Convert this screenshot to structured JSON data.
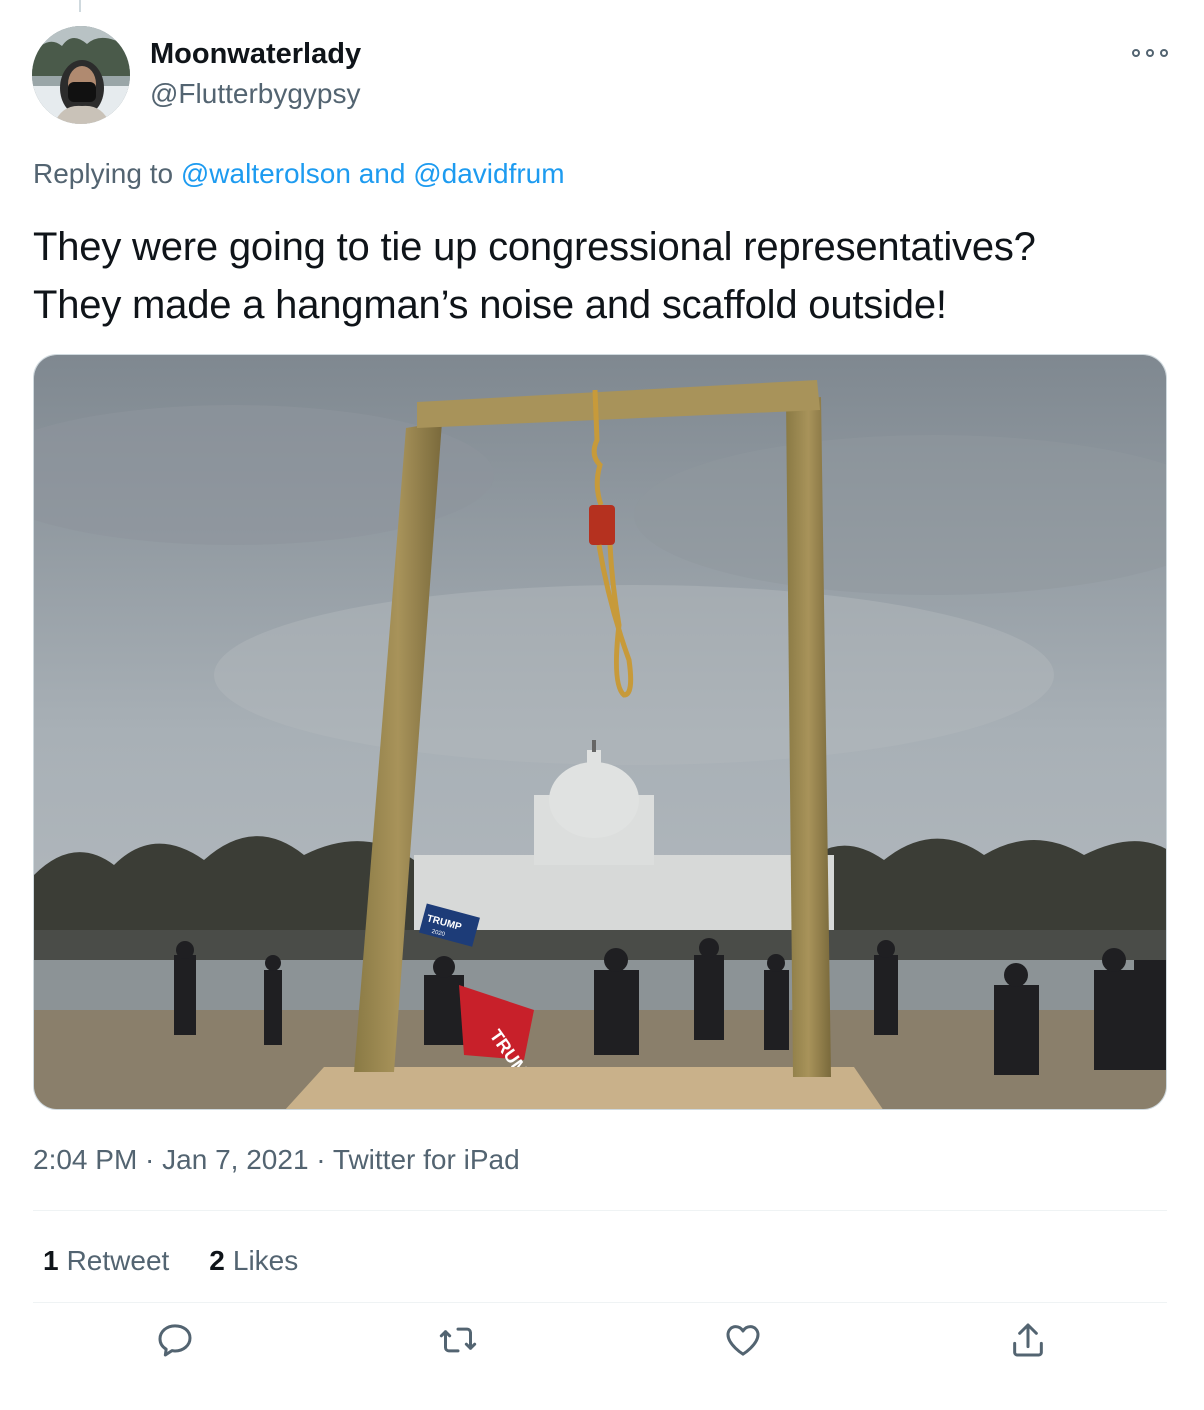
{
  "tweet": {
    "display_name": "Moonwaterlady",
    "handle": "@Flutterbygypsy",
    "replying_prefix": "Replying to ",
    "replying_user1": "@walterolson",
    "replying_and": " and ",
    "replying_user2": "@davidfrum",
    "text_line1": "They were going to tie up congressional representatives?",
    "text_line2": "They made a hangman’s noise and scaffold outside!",
    "time": "2:04 PM",
    "separator": " · ",
    "date": "Jan 7, 2021",
    "source": "Twitter for iPad"
  },
  "stats": {
    "retweets_count": "1",
    "retweets_label": "Retweet",
    "likes_count": "2",
    "likes_label": "Likes"
  },
  "media": {
    "sign_text": "TRUMP",
    "sign_sub": "2020",
    "flag_text": "TRUM"
  },
  "icons": {
    "reply": "reply-icon",
    "retweet": "retweet-icon",
    "like": "heart-icon",
    "share": "share-icon",
    "more": "more-icon"
  },
  "colors": {
    "accent": "#1d9bf0",
    "secondary_text": "#536471"
  }
}
